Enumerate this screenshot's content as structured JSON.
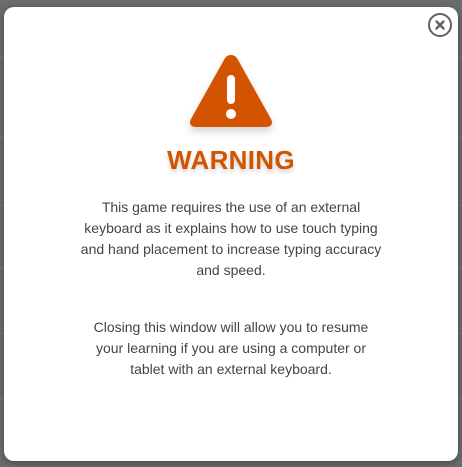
{
  "modal": {
    "title": "WARNING",
    "close_icon": "close-icon",
    "warning_icon": "warning-triangle-icon",
    "accent_color": "#d35400",
    "paragraph1": [
      "This game requires the use of an external",
      "keyboard as it explains how to use touch typing",
      "and hand placement to increase typing accuracy",
      "and speed."
    ],
    "paragraph2": [
      "Closing this window will allow you to resume",
      "your learning if you are using a computer or",
      "tablet with an external keyboard."
    ]
  }
}
